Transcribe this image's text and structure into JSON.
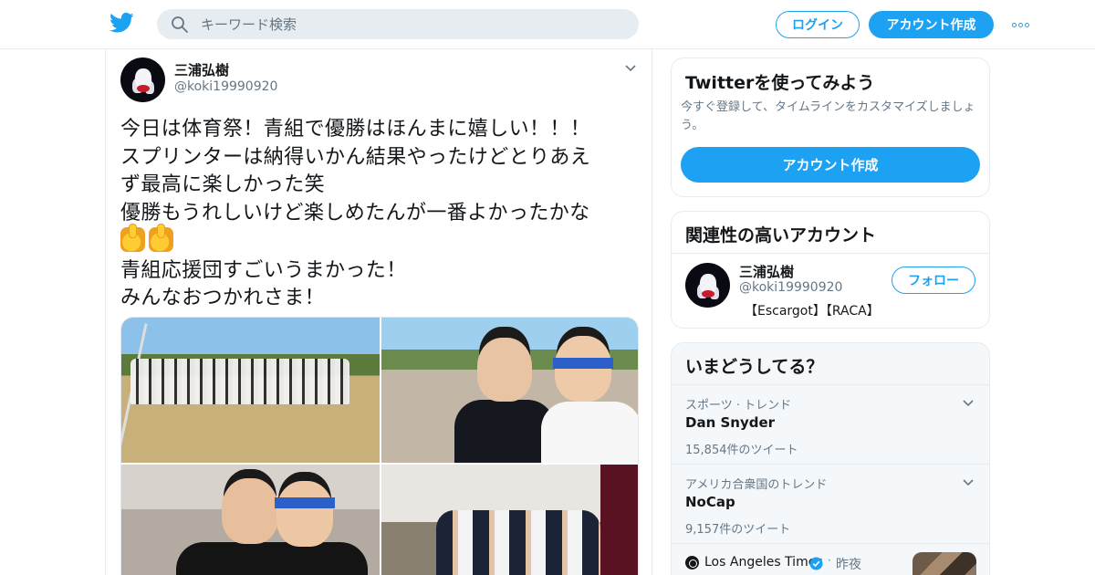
{
  "header": {
    "search_placeholder": "キーワード検索",
    "login_label": "ログイン",
    "signup_label": "アカウント作成",
    "icons": [
      "twitter-logo-icon",
      "search-icon",
      "more-icon"
    ],
    "accent_color": "#1da1f2"
  },
  "tweet": {
    "display_name": "三浦弘樹",
    "username": "@koki19990920",
    "text_lines": [
      "今日は体育祭！青組で優勝はほんまに嬉しい！！！",
      "スプリンターは納得いかん結果やったけどとりあえ",
      "ず最高に楽しかった笑",
      "優勝もうれしいけど楽しめたんが一番よかったかな",
      "青組応援団すごいうまかった！",
      "みんなおつかれさま！"
    ],
    "emoji": [
      "thumbs-up",
      "thumbs-up"
    ],
    "media_count": 4
  },
  "sidebar": {
    "signup_card": {
      "title": "Twitterを使ってみよう",
      "description": "今すぐ登録して、タイムラインをカスタマイズしましょう。",
      "button_label": "アカウント作成"
    },
    "related_card": {
      "title": "関連性の高いアカウント",
      "account": {
        "name": "三浦弘樹",
        "handle": "@koki19990920",
        "bio": "【Escargot】【RACA】",
        "follow_label": "フォロー"
      }
    },
    "trends_card": {
      "title": "いまどうしてる？",
      "trends": [
        {
          "context": "スポーツ · トレンド",
          "name": "Dan Snyder",
          "count": "15,854件のツイート"
        },
        {
          "context": "アメリカ合衆国のトレンド",
          "name": "NoCap",
          "count": "9,157件のツイート"
        }
      ],
      "news": {
        "source": "Los Angeles Times",
        "dot": "·",
        "time": "昨夜"
      }
    }
  }
}
